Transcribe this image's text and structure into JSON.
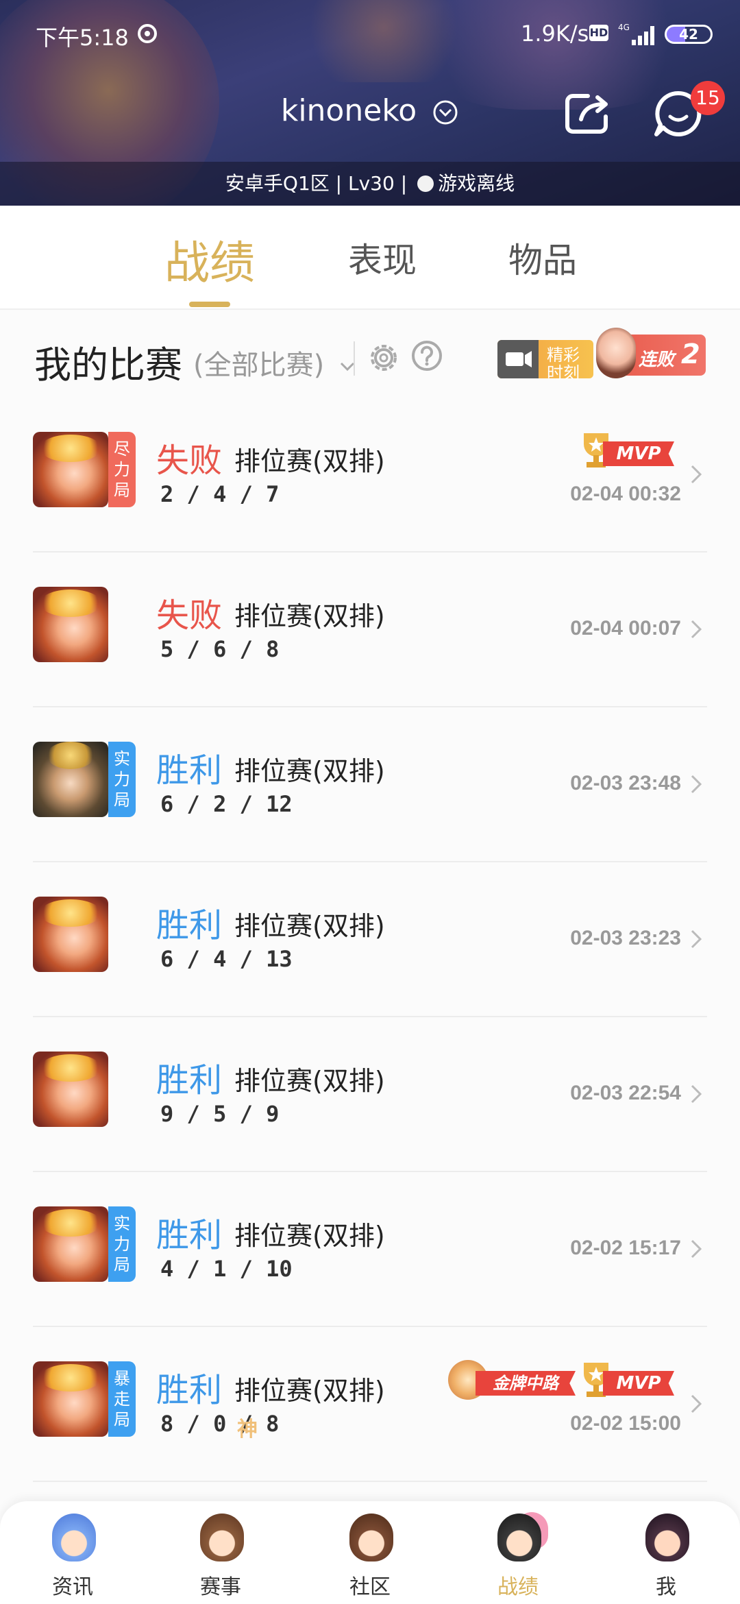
{
  "status_bar": {
    "time": "下午5:18",
    "net_speed": "1.9K/s",
    "hd": "HD",
    "network": "4G",
    "battery": "42"
  },
  "header": {
    "username": "kinoneko",
    "message_badge": "15",
    "profile_line_left": "安卓手Q1区 | Lv30 |",
    "profile_status": "游戏离线"
  },
  "tabs": [
    {
      "label": "战绩",
      "active": true
    },
    {
      "label": "表现",
      "active": false
    },
    {
      "label": "物品",
      "active": false
    }
  ],
  "section": {
    "title": "我的比赛",
    "filter": "(全部比赛)",
    "highlight_line1": "精彩",
    "highlight_line2": "时刻",
    "streak_label": "连败",
    "streak_count": "2"
  },
  "matches": [
    {
      "result": "失败",
      "mode": "排位赛(双排)",
      "kda": "2 / 4 / 7",
      "time": "02-04 00:32",
      "tag": "尽力局",
      "mvp": "MVP"
    },
    {
      "result": "失败",
      "mode": "排位赛(双排)",
      "kda": "5 / 6 / 8",
      "time": "02-04 00:07"
    },
    {
      "result": "胜利",
      "mode": "排位赛(双排)",
      "kda": "6 / 2 / 12",
      "time": "02-03 23:48",
      "tag": "实力局"
    },
    {
      "result": "胜利",
      "mode": "排位赛(双排)",
      "kda": "6 / 4 / 13",
      "time": "02-03 23:23"
    },
    {
      "result": "胜利",
      "mode": "排位赛(双排)",
      "kda": "9 / 5 / 9",
      "time": "02-03 22:54"
    },
    {
      "result": "胜利",
      "mode": "排位赛(双排)",
      "kda": "4 / 1 / 10",
      "time": "02-02 15:17",
      "tag": "实力局"
    },
    {
      "result": "胜利",
      "mode": "排位赛(双排)",
      "kda": "8 / 0 / 8",
      "time": "02-02 15:00",
      "tag": "暴走局",
      "god": "神",
      "gold": "金牌中路",
      "mvp": "MVP"
    }
  ],
  "bottom_nav": [
    {
      "label": "资讯"
    },
    {
      "label": "赛事"
    },
    {
      "label": "社区"
    },
    {
      "label": "战绩",
      "active": true
    },
    {
      "label": "我"
    }
  ],
  "colors": {
    "accent_gold": "#d8b25a",
    "lose_red": "#e8554b",
    "win_blue": "#3e98e8",
    "badge_red": "#f03c3c"
  }
}
